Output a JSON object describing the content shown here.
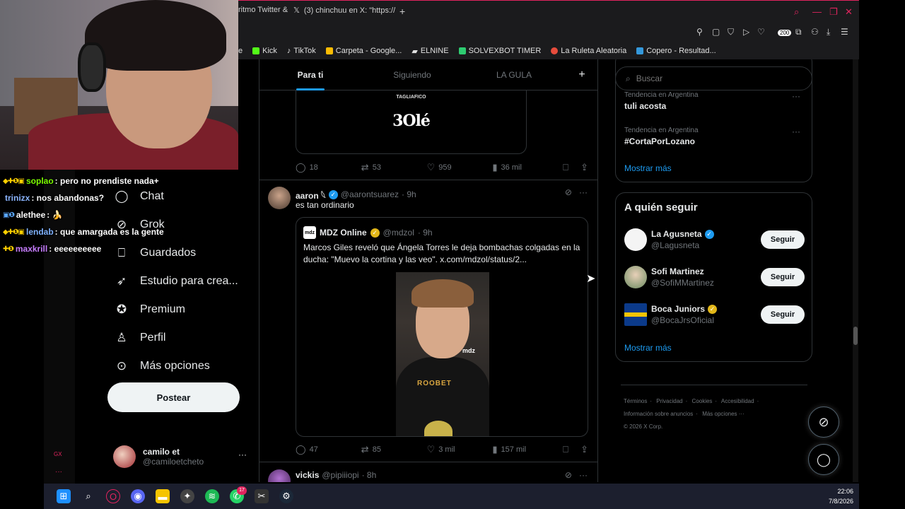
{
  "browser": {
    "tabs": [
      {
        "label": "ritmo Twitter &"
      },
      {
        "label": "(3) chinchuu en X: \"https://"
      }
    ],
    "new_tab_icon": "plus-icon",
    "extension_badge": "200",
    "bookmarks": [
      {
        "label": "e",
        "color": "#000000"
      },
      {
        "label": "Kick",
        "color": "#53fc18"
      },
      {
        "label": "TikTok",
        "color": "#ffffff"
      },
      {
        "label": "Carpeta - Google...",
        "color": "#fbbc04"
      },
      {
        "label": "ELNINE",
        "color": "#ffffff"
      },
      {
        "label": "SOLVEXBOT TIMER",
        "color": "#2ecc71"
      },
      {
        "label": "La Ruleta Aleatoria",
        "color": "#e74c3c"
      },
      {
        "label": "Copero - Resultad...",
        "color": "#3498db"
      }
    ]
  },
  "chat": {
    "messages": [
      {
        "user": "soplao",
        "color": "#7cfc00",
        "badges": "◆✚❶▣",
        "text": ": pero no prendiste nada+"
      },
      {
        "user": "trinizx",
        "color": "#8ab4ff",
        "badges": "",
        "text": ": nos abandonas?"
      },
      {
        "user": "alethee",
        "color": "#ffffff",
        "badges": "▣❶",
        "text": ": 🍌"
      },
      {
        "user": "lendab",
        "color": "#7fb2ff",
        "badges": "◆✚❶▣",
        "text": ": que amargada es la gente"
      },
      {
        "user": "maxkrill",
        "color": "#c77dff",
        "badges": "✚❶",
        "text": ": eeeeeeeeee"
      }
    ]
  },
  "sidebar_x": {
    "nav": [
      {
        "label": "Chat",
        "icon": "chat-icon"
      },
      {
        "label": "Grok",
        "icon": "grok-icon"
      },
      {
        "label": "Guardados",
        "icon": "bookmark-icon"
      },
      {
        "label": "Estudio para crea...",
        "icon": "rocket-icon"
      },
      {
        "label": "Premium",
        "icon": "premium-icon"
      },
      {
        "label": "Perfil",
        "icon": "person-icon"
      },
      {
        "label": "Más opciones",
        "icon": "more-circle-icon"
      }
    ],
    "post_button": "Postear",
    "account": {
      "name": "camilo et",
      "handle": "@camiloetcheto"
    },
    "gx_label": "GX"
  },
  "timeline": {
    "tabs": [
      {
        "label": "Para ti",
        "active": true
      },
      {
        "label": "Siguiendo",
        "active": false
      },
      {
        "label": "LA GULA",
        "active": false
      }
    ],
    "prev_media": {
      "top_text": "TAGLIAFICO",
      "logo": "3Olé"
    },
    "prev_actions": {
      "replies": "18",
      "reposts": "53",
      "likes": "959",
      "views": "36 mil"
    },
    "tweet": {
      "name": "aaron 𓆩",
      "handle": "@aarontsuarez",
      "time": "· 9h",
      "text": "es tan ordinario",
      "quote": {
        "avatar_text": "mdz",
        "name": "MDZ Online",
        "handle": "@mdzol",
        "time": "· 9h",
        "text": "Marcos Giles reveló que Ángela Torres le deja bombachas colgadas en la ducha: \"Muevo la cortina y las veo\".  x.com/mdzol/status/2...",
        "media_brand": "ROOBET",
        "media_tag": "mdz"
      },
      "actions": {
        "replies": "47",
        "reposts": "85",
        "likes": "3 mil",
        "views": "157 mil"
      }
    },
    "next_tweet": {
      "name": "vickis",
      "handle": "@pipiiiopi",
      "time": "· 8h"
    }
  },
  "right": {
    "search_placeholder": "Buscar",
    "trends": [
      {
        "context": "Tendencia en Argentina",
        "name": "tuli acosta"
      },
      {
        "context": "Tendencia en Argentina",
        "name": "#CortaPorLozano"
      }
    ],
    "show_more": "Mostrar más",
    "who_to_follow": {
      "title": "A quién seguir",
      "accounts": [
        {
          "name": "La Agusneta",
          "handle": "@Lagusneta",
          "verified": "blue",
          "button": "Seguir"
        },
        {
          "name": "Sofi Martinez",
          "handle": "@SofiMMartinez",
          "verified": "",
          "button": "Seguir"
        },
        {
          "name": "Boca Juniors",
          "handle": "@BocaJrsOficial",
          "verified": "gold",
          "button": "Seguir"
        }
      ],
      "show_more": "Mostrar más"
    },
    "footer": [
      "Términos",
      "·",
      "Privacidad",
      "·",
      "Cookies",
      "·",
      "Accesibilidad",
      "·",
      "Información sobre anuncios",
      "·",
      "Más opciones ···",
      "© 2026 X Corp."
    ]
  },
  "taskbar": {
    "time": "22:06",
    "date": "7/8/2026",
    "whatsapp_badge": "17"
  },
  "colors": {
    "accent": "#1d9bf0",
    "opera": "#e0245e",
    "background": "#000000"
  }
}
